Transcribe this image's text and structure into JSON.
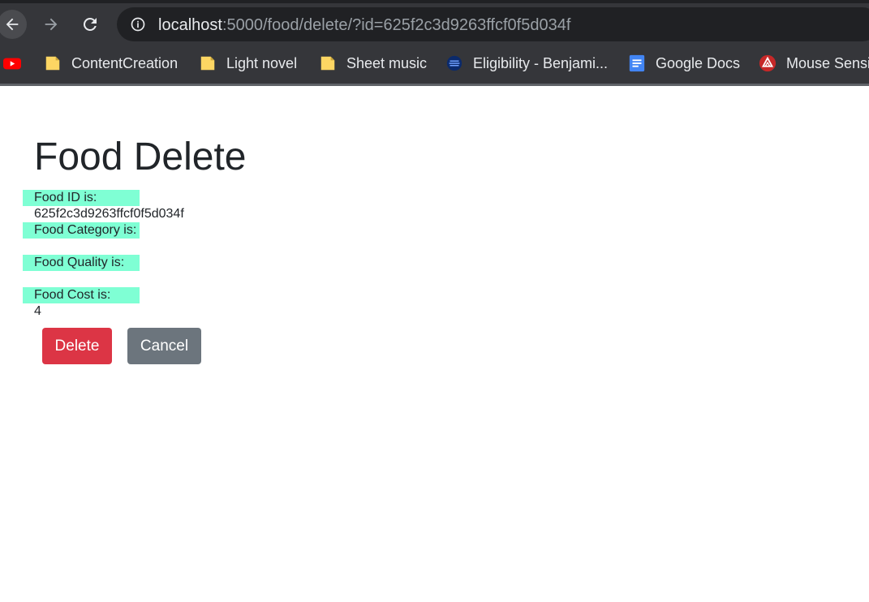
{
  "browser": {
    "url_host": "localhost",
    "url_rest": ":5000/food/delete/?id=625f2c3d9263ffcf0f5d034f",
    "bookmarks": [
      {
        "label": "",
        "icon": "youtube-icon"
      },
      {
        "label": "ContentCreation",
        "icon": "folder-icon"
      },
      {
        "label": "Light novel",
        "icon": "folder-icon"
      },
      {
        "label": "Sheet music",
        "icon": "folder-icon"
      },
      {
        "label": "Eligibility - Benjami...",
        "icon": "site-icon"
      },
      {
        "label": "Google Docs",
        "icon": "google-docs-icon"
      },
      {
        "label": "Mouse Sensi",
        "icon": "site-icon"
      }
    ]
  },
  "page": {
    "title": "Food Delete",
    "fields": [
      {
        "label": "Food ID is:",
        "value": "625f2c3d9263ffcf0f5d034f"
      },
      {
        "label": "Food Category is:",
        "value": ""
      },
      {
        "label": "Food Quality is:",
        "value": ""
      },
      {
        "label": "Food Cost is:",
        "value": "4"
      }
    ],
    "delete_label": "Delete",
    "cancel_label": "Cancel"
  },
  "colors": {
    "label_highlight": "#7fffd4",
    "danger": "#dc3545",
    "secondary": "#6c757d",
    "chrome": "#35363a"
  }
}
